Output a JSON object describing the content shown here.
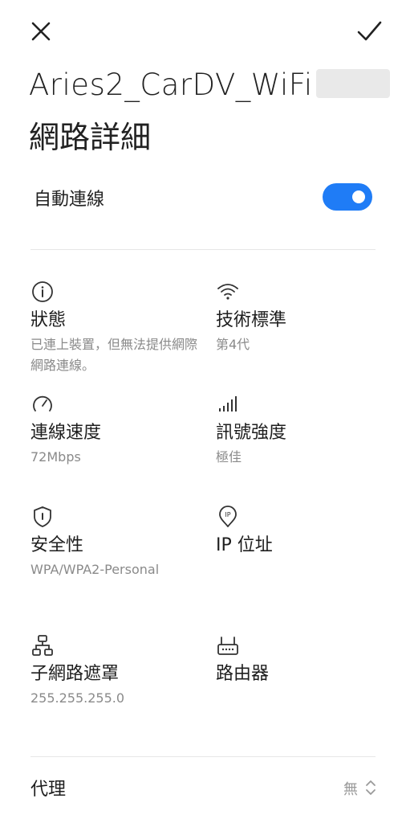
{
  "header": {
    "close_icon": "close-icon",
    "confirm_icon": "checkmark-icon",
    "network_name": "Aries2_CarDV_WiFi",
    "subtitle": "網路詳細"
  },
  "auto_connect": {
    "label": "自動連線",
    "enabled": true,
    "accent_color": "#1f7cf6"
  },
  "details": [
    {
      "icon": "info-icon",
      "label": "狀態",
      "value": "已連上裝置，但無法提供網際網路連線。"
    },
    {
      "icon": "wifi-icon",
      "label": "技術標準",
      "value": "第4代"
    },
    {
      "icon": "speedometer-icon",
      "label": "連線速度",
      "value": "72Mbps"
    },
    {
      "icon": "signal-strength-icon",
      "label": "訊號強度",
      "value": "極佳"
    },
    {
      "icon": "shield-icon",
      "label": "安全性",
      "value": "WPA/WPA2-Personal"
    },
    {
      "icon": "ip-location-icon",
      "label": "IP 位址",
      "value": ""
    },
    {
      "icon": "subnet-network-icon",
      "label": "子網路遮罩",
      "value": "255.255.255.0"
    },
    {
      "icon": "router-icon",
      "label": "路由器",
      "value": ""
    }
  ],
  "proxy": {
    "label": "代理",
    "value": "無",
    "icon": "chevron-updown-icon"
  }
}
